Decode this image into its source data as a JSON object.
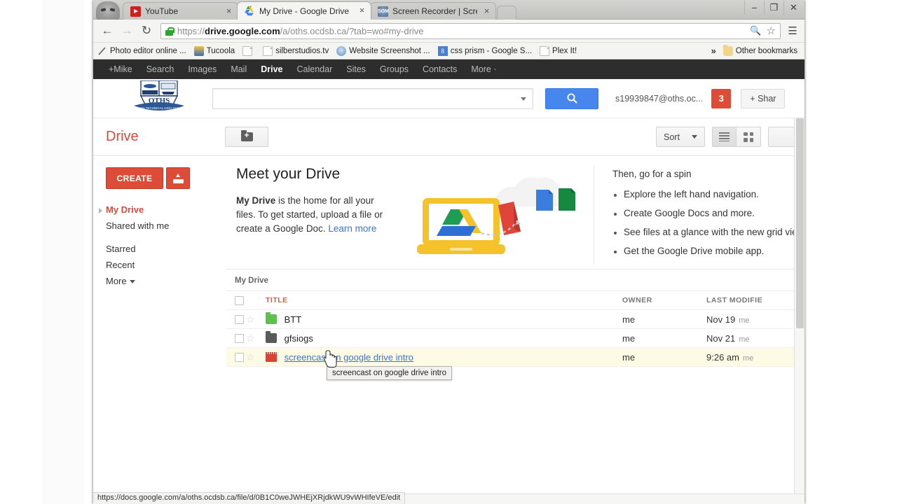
{
  "browser": {
    "tabs": [
      {
        "title": "YouTube",
        "favicon": "youtube-icon",
        "active": false
      },
      {
        "title": "My Drive - Google Drive",
        "favicon": "google-drive-icon",
        "active": true
      },
      {
        "title": "Screen Recorder | Screenc",
        "favicon": "screencast-icon",
        "active": false
      }
    ],
    "tab_close_glyph": "×",
    "window_controls": {
      "minimize": "–",
      "maximize": "❐",
      "close": "✕"
    },
    "nav": {
      "back": "←",
      "forward": "→",
      "reload": "↻"
    },
    "omnibox": {
      "scheme": "https://",
      "domain": "drive.google.com",
      "path": "/a/oths.ocdsb.ca/?tab=wo#my-drive",
      "full_url": "https://drive.google.com/a/oths.ocdsb.ca/?tab=wo#my-drive",
      "lock_icon": "secure-lock-icon",
      "zoom_icon": "🔍",
      "star_icon": "☆",
      "menu_icon": "☰"
    },
    "bookmarks": [
      {
        "label": "Photo editor online ...",
        "icon": "pencil-icon"
      },
      {
        "label": "Tucoola",
        "icon": "tucoola-icon"
      },
      {
        "label": "",
        "icon": "page-icon"
      },
      {
        "label": "silberstudios.tv",
        "icon": "page-icon"
      },
      {
        "label": "Website Screenshot ...",
        "icon": "globe-icon"
      },
      {
        "label": "css prism - Google S...",
        "icon": "css-prism-icon",
        "glyph": "8"
      },
      {
        "label": "Plex It!",
        "icon": "page-icon"
      }
    ],
    "bookmarks_overflow_glyph": "»",
    "other_bookmarks": {
      "label": "Other bookmarks",
      "icon": "folder-icon"
    },
    "status_bar_url": "https://docs.google.com/a/oths.ocdsb.ca/file/d/0B1C0weJWHEjXRjdkWU9vWHIfeVE/edit"
  },
  "gbar": {
    "items": [
      {
        "label": "+Mike",
        "active": false
      },
      {
        "label": "Search",
        "active": false
      },
      {
        "label": "Images",
        "active": false
      },
      {
        "label": "Mail",
        "active": false
      },
      {
        "label": "Drive",
        "active": true
      },
      {
        "label": "Calendar",
        "active": false
      },
      {
        "label": "Sites",
        "active": false
      },
      {
        "label": "Groups",
        "active": false
      },
      {
        "label": "Contacts",
        "active": false
      },
      {
        "label": "More ·",
        "active": false
      }
    ]
  },
  "header": {
    "logo_name": "oths-school-crest-logo",
    "search_value": "",
    "search_placeholder": "",
    "search_dropdown_icon": "chevron-down-icon",
    "search_button_icon": "search-icon",
    "account_email": "s19939847@oths.oc...",
    "notification_count": "3",
    "share_label": "+ Shar"
  },
  "toolbar": {
    "app_name": "Drive",
    "new_folder_icon": "new-folder-icon",
    "sort_label": "Sort",
    "sort_caret": "chevron-down-icon",
    "list_view_icon": "list-view-icon",
    "grid_view_icon": "grid-view-icon",
    "list_view_active": true
  },
  "sidebar": {
    "create_label": "CREATE",
    "upload_icon": "upload-icon",
    "items": [
      {
        "label": "My Drive",
        "selected": true
      },
      {
        "label": "Shared with me",
        "selected": false
      },
      {
        "label": "Starred",
        "selected": false
      },
      {
        "label": "Recent",
        "selected": false
      },
      {
        "label": "More",
        "selected": false,
        "has_caret": true
      }
    ]
  },
  "promo": {
    "heading": "Meet your Drive",
    "body_bold": "My Drive",
    "body_text": " is the home for all your files. To get started, upload a file or create a Google Doc. ",
    "learn_more": "Learn more",
    "right_heading": "Then, go for a spin",
    "bullets": [
      "Explore the left hand navigation.",
      "Create Google Docs and more.",
      "See files at a glance with the new grid vie",
      "Get the Google Drive mobile app."
    ],
    "illustration_name": "google-drive-illustration"
  },
  "file_list": {
    "section_label": "My Drive",
    "columns": [
      "",
      "",
      "TITLE",
      "OWNER",
      "LAST MODIFIE"
    ],
    "rows": [
      {
        "title": "BTT",
        "icon": "folder-icon-green",
        "owner": "me",
        "modified": "Nov 19",
        "modified_by": "me",
        "selected": false,
        "is_link": false
      },
      {
        "title": "gfsiogs",
        "icon": "folder-icon-gray",
        "owner": "me",
        "modified": "Nov 21",
        "modified_by": "me",
        "selected": false,
        "is_link": false
      },
      {
        "title": "screencast on google drive intro",
        "icon": "video-file-icon",
        "owner": "me",
        "modified": "9:26 am",
        "modified_by": "me",
        "selected": true,
        "is_link": true
      }
    ],
    "star_glyph": "☆"
  },
  "tooltip": {
    "text": "screencast on google drive intro"
  },
  "colors": {
    "drive_red": "#dd4b39",
    "link_blue": "#3b73d2",
    "search_blue": "#4787ed",
    "row_highlight": "#fdfbe6",
    "folder_green": "#5cc24b",
    "folder_gray": "#5a5a5a",
    "video_red": "#d94234",
    "gbar_dark": "#2d2d2d"
  }
}
